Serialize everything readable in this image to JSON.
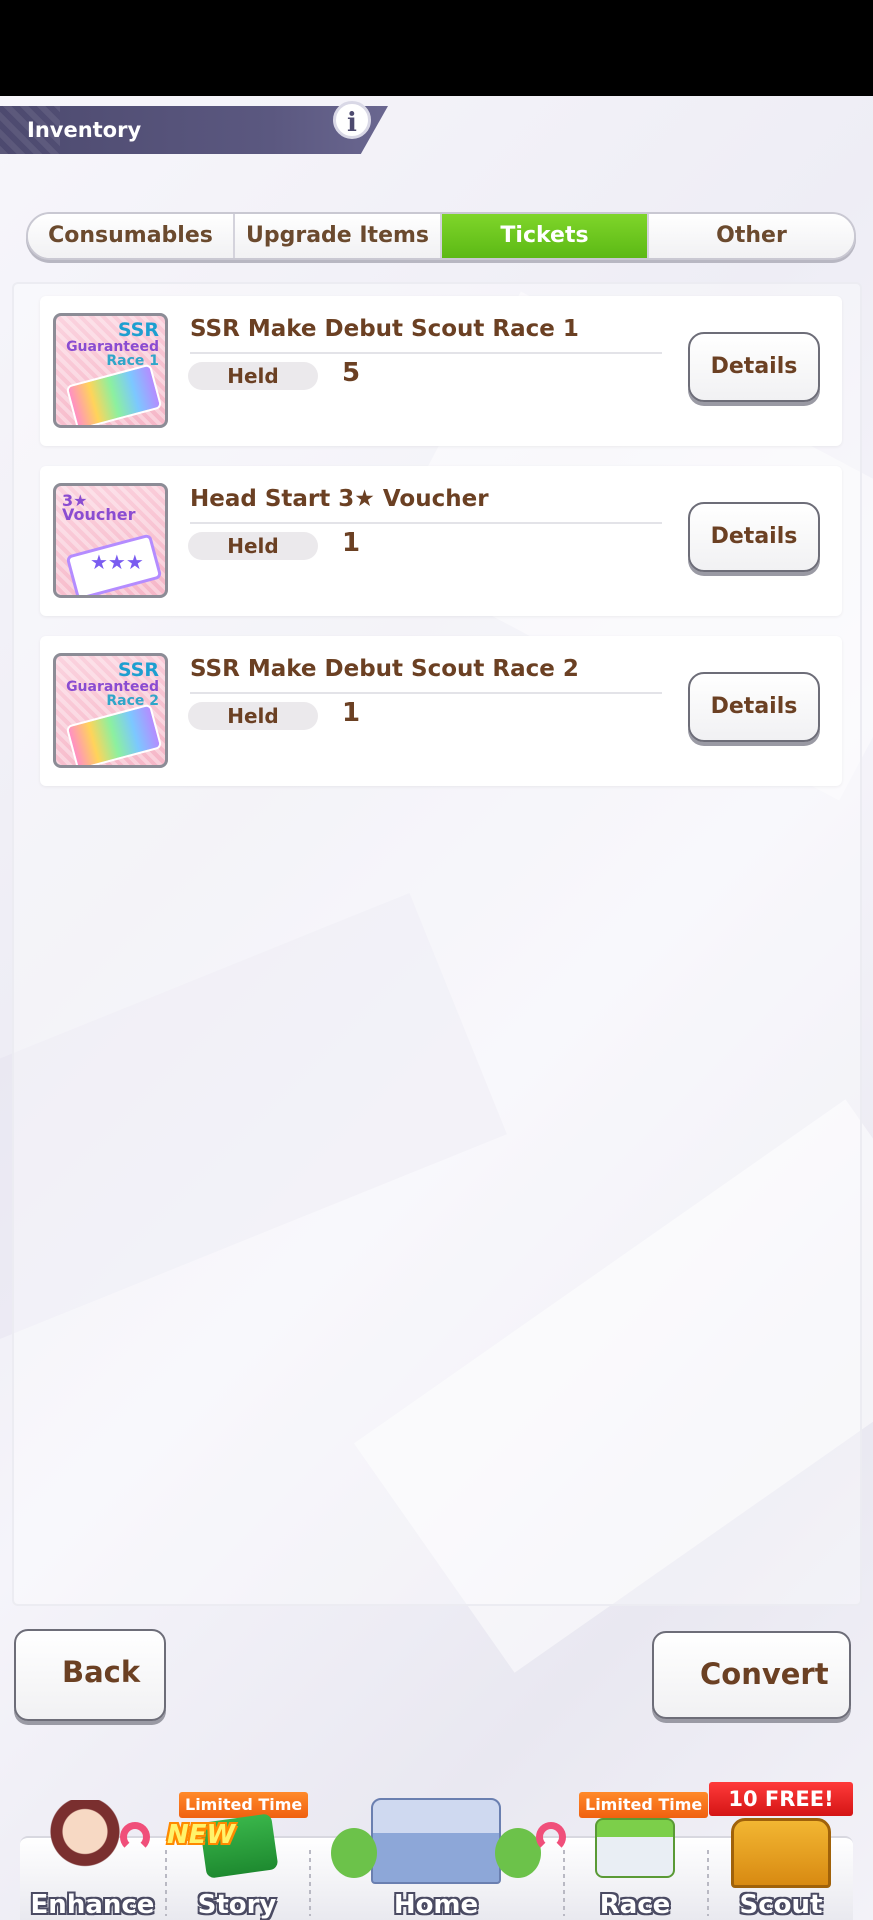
{
  "header": {
    "title": "Inventory",
    "info_label": "i"
  },
  "tabs": [
    {
      "label": "Consumables",
      "active": false
    },
    {
      "label": "Upgrade Items",
      "active": false
    },
    {
      "label": "Tickets",
      "active": true
    },
    {
      "label": "Other",
      "active": false
    }
  ],
  "items": [
    {
      "name": "SSR Make Debut Scout Race 1",
      "held_label": "Held",
      "held_count": "5",
      "details_label": "Details",
      "icon": {
        "name": "ssr-ticket-icon",
        "line1": "SSR",
        "line2": "Guaranteed",
        "line3": "Race 1"
      }
    },
    {
      "name": "Head Start 3★ Voucher",
      "held_label": "Held",
      "held_count": "1",
      "details_label": "Details",
      "icon": {
        "name": "voucher-ticket-icon",
        "line1": "3★ Voucher",
        "stars": "★★★"
      }
    },
    {
      "name": "SSR Make Debut Scout Race 2",
      "held_label": "Held",
      "held_count": "1",
      "details_label": "Details",
      "icon": {
        "name": "ssr-ticket-icon",
        "line1": "SSR",
        "line2": "Guaranteed",
        "line3": "Race 2"
      }
    }
  ],
  "actions": {
    "back_label": "Back",
    "convert_label": "Convert"
  },
  "nav": {
    "enhance": {
      "label": "Enhance",
      "icon": "character-icon"
    },
    "story": {
      "label": "Story",
      "badge": "Limited Time",
      "new_tag": "NEW",
      "icon": "book-icon"
    },
    "home": {
      "label": "Home",
      "icon": "school-building-icon"
    },
    "race": {
      "label": "Race",
      "badge": "Limited Time",
      "icon": "race-gate-icon"
    },
    "scout": {
      "label": "Scout",
      "badge": "10 FREE!",
      "icon": "gate-icon"
    }
  },
  "colors": {
    "accent_green": "#5cb915",
    "text_brown": "#6b4023",
    "header_bg": "#4d4a6f",
    "badge_orange": "#f06010",
    "badge_red": "#d41515"
  }
}
